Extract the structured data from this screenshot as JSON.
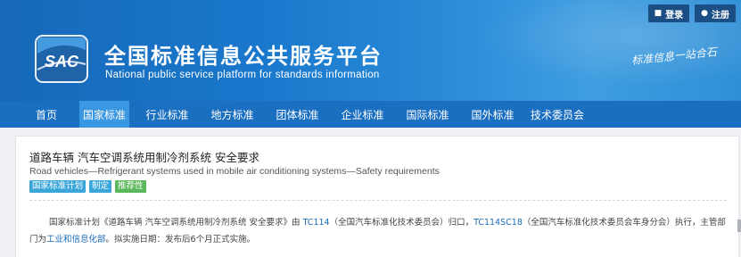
{
  "header": {
    "login_label": "登录",
    "register_label": "注册",
    "logo_text": "SAC",
    "title_cn": "全国标准信息公共服务平台",
    "title_en": "National public service platform  for standards information",
    "slogan": "标准信息一站合石"
  },
  "nav": {
    "items": [
      {
        "label": "首页"
      },
      {
        "label": "国家标准"
      },
      {
        "label": "行业标准"
      },
      {
        "label": "地方标准"
      },
      {
        "label": "团体标准"
      },
      {
        "label": "企业标准"
      },
      {
        "label": "国际标准"
      },
      {
        "label": "国外标准"
      },
      {
        "label": "技术委员会"
      }
    ],
    "active_index": 1
  },
  "standard": {
    "title_cn": "道路车辆 汽车空调系统用制冷剂系统 安全要求",
    "title_en": "Road vehicles—Refrigerant systems used in mobile air conditioning systems—Safety requirements",
    "badges": [
      "国家标准计划",
      "制定",
      "推荐性"
    ],
    "desc": {
      "p1": "国家标准计划《道路车辆 汽车空调系统用制冷剂系统 安全要求》由 ",
      "tc1": "TC114",
      "p2": "（全国汽车标准化技术委员会）归口，",
      "tc2": "TC114SC18",
      "p3": "（全国汽车标准化技术委员会车身分会）执行，主管部门为",
      "dept": "工业和信息化部",
      "p4": "。拟实施日期：发布后6个月正式实施。"
    }
  },
  "colors": {
    "header_blue": "#1a78cc",
    "nav_blue": "#1b6fc1",
    "nav_active": "#3a97e2",
    "link": "#1a6cb8",
    "badge_blue": "#3aa6d9",
    "badge_green": "#5cb85c"
  }
}
